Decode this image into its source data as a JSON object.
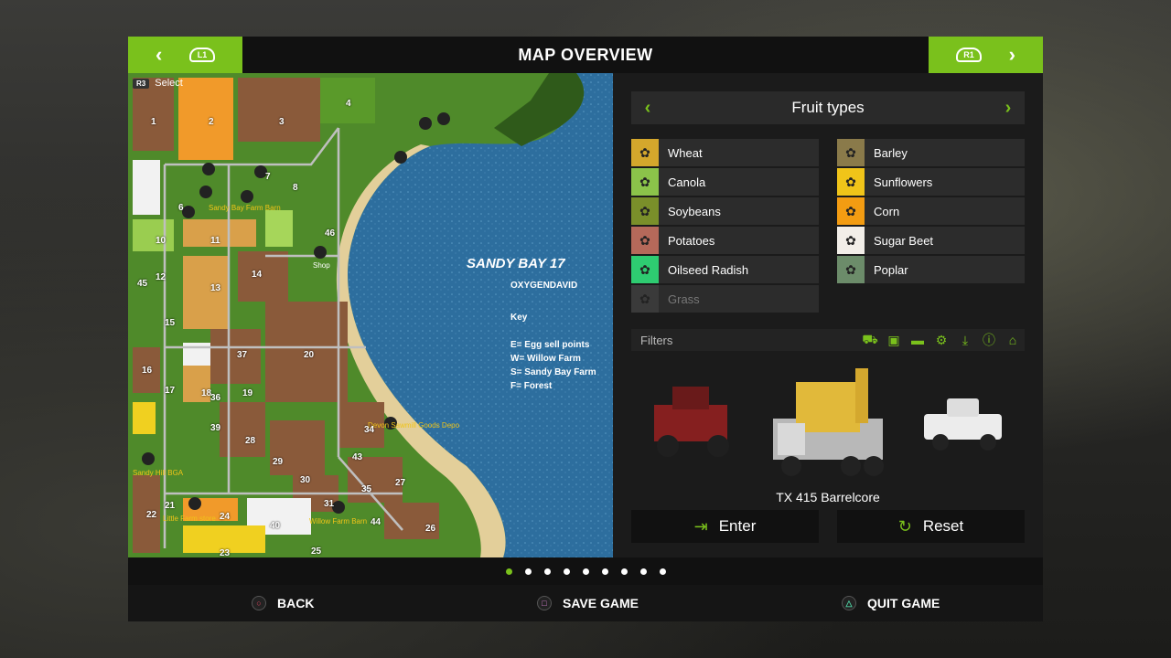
{
  "header": {
    "title": "MAP OVERVIEW",
    "left_shoulder": "L1",
    "right_shoulder": "R1"
  },
  "map_hint": {
    "button": "R3",
    "label": "Select"
  },
  "map": {
    "title": "SANDY BAY 17",
    "author": "OXYGENDAVID",
    "key_title": "Key",
    "key_lines": [
      "E= Egg sell points",
      "W= Willow Farm",
      "S= Sandy Bay Farm",
      "F= Forest"
    ],
    "place_labels": [
      "Sandy Bay Farm Barn",
      "Shop",
      "Devon Sawmill Goods Depo",
      "Willow Farm Barn",
      "Sandy Hill BGA",
      "Little Farm store"
    ],
    "field_numbers": [
      "1",
      "2",
      "3",
      "4",
      "6",
      "7",
      "8",
      "10",
      "11",
      "12",
      "13",
      "14",
      "15",
      "16",
      "17",
      "18",
      "19",
      "20",
      "21",
      "22",
      "23",
      "24",
      "25",
      "26",
      "27",
      "28",
      "29",
      "30",
      "31",
      "34",
      "35",
      "36",
      "37",
      "39",
      "40",
      "43",
      "44",
      "45",
      "46"
    ]
  },
  "fruit_panel": {
    "title": "Fruit types",
    "fruits": [
      {
        "label": "Wheat",
        "color": "#d4a72c"
      },
      {
        "label": "Barley",
        "color": "#8a7a4a"
      },
      {
        "label": "Canola",
        "color": "#8bc34a"
      },
      {
        "label": "Sunflowers",
        "color": "#f0c419"
      },
      {
        "label": "Soybeans",
        "color": "#7a8f2a"
      },
      {
        "label": "Corn",
        "color": "#f39c12"
      },
      {
        "label": "Potatoes",
        "color": "#b5695a"
      },
      {
        "label": "Sugar Beet",
        "color": "#f2eee8"
      },
      {
        "label": "Oilseed Radish",
        "color": "#2ecc71"
      },
      {
        "label": "Poplar",
        "color": "#6c8c6a"
      },
      {
        "label": "Grass",
        "color": "#3a3a3a"
      }
    ],
    "filters_label": "Filters",
    "vehicle_name": "TX 415 Barrelcore",
    "enter_label": "Enter",
    "reset_label": "Reset"
  },
  "pager": {
    "count": 9,
    "active": 0
  },
  "footer": {
    "back": "BACK",
    "save": "SAVE GAME",
    "quit": "QUIT GAME"
  },
  "colors": {
    "accent": "#7ac11c"
  }
}
